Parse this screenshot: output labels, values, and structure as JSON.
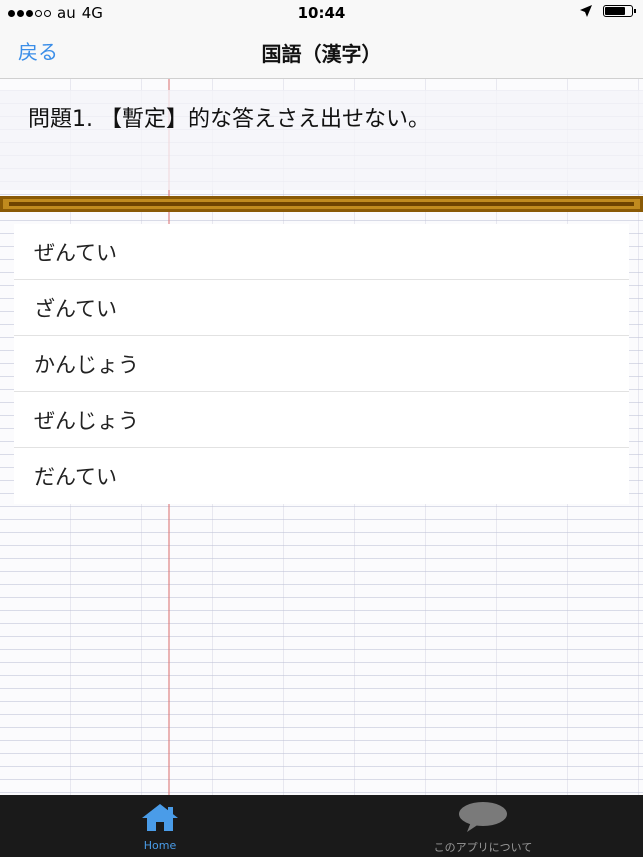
{
  "status_bar": {
    "carrier": "au",
    "network": "4G",
    "time": "10:44",
    "signal_bars_filled": 3,
    "signal_bars_total": 5,
    "battery_level": 0.7
  },
  "nav": {
    "back_label": "戻る",
    "title": "国語（漢字）"
  },
  "question": {
    "text": "問題1. 【暫定】的な答えさえ出せない。"
  },
  "answers": [
    {
      "label": "ぜんてい"
    },
    {
      "label": "ざんてい"
    },
    {
      "label": "かんじょう"
    },
    {
      "label": "ぜんじょう"
    },
    {
      "label": "だんてい"
    }
  ],
  "tabs": [
    {
      "label": "Home",
      "icon": "home-icon",
      "active": true
    },
    {
      "label": "このアプリについて",
      "icon": "speech-bubble-icon",
      "active": false
    }
  ],
  "colors": {
    "accent": "#3b8ee8",
    "tab_active": "#4a9ce8",
    "tab_inactive": "#9a9a9a",
    "divider": "#c08a1e"
  }
}
